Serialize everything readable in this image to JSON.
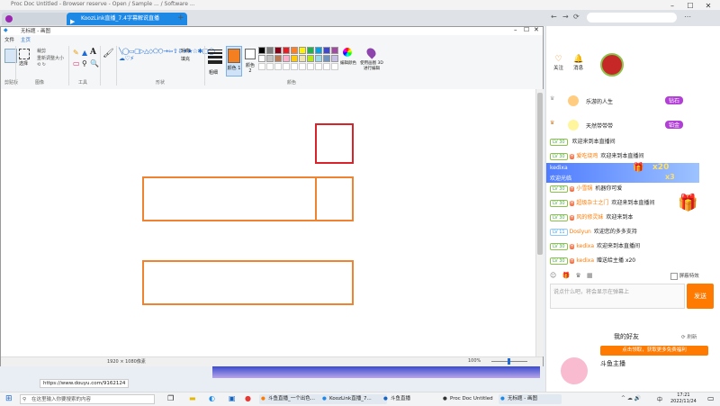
{
  "browser": {
    "title": "Proc Doc Untitled - Browser reserve - Open / Sample ... / Software ...",
    "tabs": [
      {
        "label": ""
      },
      {
        "label": "KoozLink直播_7.4字幕解说直播"
      }
    ]
  },
  "paint": {
    "title": "无标题 - 画图",
    "menu": [
      "文件",
      "主页"
    ],
    "ribbon": {
      "clipboard_label": "剪贴板",
      "image_label": "图像",
      "tools_label": "工具",
      "shapes_label": "形状",
      "colors_label": "颜色",
      "select_label": "选择",
      "crop_label": "裁剪",
      "resize_label": "重新调整大小",
      "outline_label": "轮廓",
      "fill_label": "填充",
      "size_label": "粗细",
      "color1_label": "颜色 1",
      "color2_label": "颜色 2",
      "edit_colors_label": "编辑颜色",
      "paint3d_label": "使用画图 3D 进行编辑"
    },
    "palette": [
      "#000000",
      "#7f7f7f",
      "#880015",
      "#ed1c24",
      "#ff7f27",
      "#fff200",
      "#22b14c",
      "#00a2e8",
      "#3f48cc",
      "#a349a4",
      "#ffffff",
      "#c3c3c3",
      "#b97a57",
      "#ffaec9",
      "#ffc90e",
      "#efe4b0",
      "#b5e61d",
      "#99d9ea",
      "#7092be",
      "#c8bfe7"
    ],
    "selected_color": "#f47f20",
    "status": {
      "cursor": "",
      "selection": "",
      "size": "1920 × 1080像素",
      "zoom": "100%"
    }
  },
  "chat": {
    "follow_label": "关注",
    "messages_label": "消息",
    "rank_rows": [
      {
        "name": "乐游的人生",
        "badge": "钻石"
      },
      {
        "name": "天然带带带",
        "badge": "铂金"
      }
    ],
    "rows": [
      {
        "lv": "LV 30",
        "user": "",
        "text": "欢迎来到本直播间"
      },
      {
        "lv": "LV 30",
        "user": "爱吃烧鸡",
        "text": "欢迎来到本直播间"
      },
      {
        "lv": "",
        "user": "kedixa",
        "text": "欢迎光临"
      },
      {
        "lv": "LV 30",
        "user": "小雪锅",
        "text": "机器你可爱"
      },
      {
        "lv": "LV 30",
        "user": "超级杂士之门",
        "text": "欢迎来到本直播间"
      },
      {
        "lv": "LV 30",
        "user": "风的修灵妹",
        "text": "欢迎来到本"
      },
      {
        "lv": "LV 11",
        "user": "Doslyun",
        "text": "欢迎您的多多支持"
      },
      {
        "lv": "LV 30",
        "user": "kedixa",
        "text": "欢迎来到本直播间"
      },
      {
        "lv": "LV 30",
        "user": "kedixa",
        "text": "赠送给主播 x20"
      }
    ],
    "gift_banner": {
      "user": "kedixa",
      "count": "x20",
      "multiplier": "x3"
    },
    "danmu_toggle": "屏蔽特效",
    "input_placeholder": "说点什么吧，将会显示在弹幕上",
    "send_label": "发送",
    "friends_label": "我的好友",
    "refresh_label": "刷新",
    "orange_banner": "点击领取，获取更多免费福利",
    "friend_name": "斗鱼主播"
  },
  "taskbar": {
    "search_placeholder": "在这里输入你要搜索的内容",
    "apps": [
      {
        "label": "斗鱼直播_一个出色..."
      },
      {
        "label": "KoozLink直播_7..."
      },
      {
        "label": "斗鱼直播"
      },
      {
        "label": "Proc Doc Untitled"
      },
      {
        "label": "无标题 - 画图"
      }
    ],
    "lang": "中",
    "time": "17:21",
    "date": "2022/11/24"
  },
  "url_status": "https://www.douyu.com/9162124"
}
